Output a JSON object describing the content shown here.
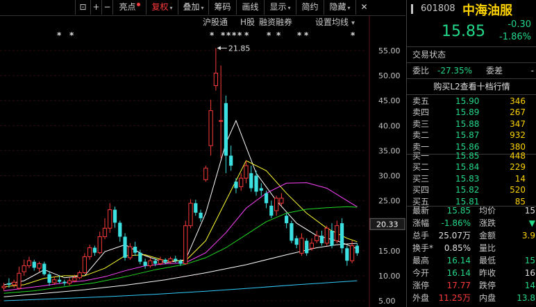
{
  "toolbar": {
    "items": [
      {
        "label": "⊡",
        "dot": false,
        "menu": false
      },
      {
        "label": "+",
        "dot": false,
        "menu": false
      },
      {
        "label": "−",
        "dot": false,
        "menu": false
      },
      {
        "label": "亮点",
        "dot": true,
        "menu": false
      },
      {
        "label": "复权",
        "dot": false,
        "menu": true
      },
      {
        "label": "叠加",
        "dot": false,
        "menu": true
      },
      {
        "label": "筹码",
        "dot": false,
        "menu": false
      },
      {
        "label": "画线",
        "dot": false,
        "menu": false
      },
      {
        "label": "显示",
        "dot": false,
        "menu": true
      },
      {
        "label": "简约",
        "dot": false,
        "menu": false
      },
      {
        "label": "隐藏",
        "dot": false,
        "menu": true
      },
      {
        "label": "✕",
        "dot": false,
        "menu": false
      }
    ]
  },
  "chart_header": {
    "tabs": [
      "沪股通",
      "H股",
      "融资融券",
      "设置均线"
    ],
    "settings_arrow": "▾"
  },
  "chart_data": {
    "type": "candlestick",
    "y_ticks": [
      "55.00",
      "50.00",
      "45.00",
      "40.00",
      "35.00",
      "30.00",
      "25.00",
      "20.00",
      "15.00",
      "10.00",
      "5.00"
    ],
    "ylim": [
      5,
      55
    ],
    "current_price_label": "20.33",
    "peak_annotation": "21.85",
    "candles": [
      {
        "o": 7.6,
        "c": 7.9,
        "h": 8.6,
        "l": 7.0
      },
      {
        "o": 8.5,
        "c": 8.2,
        "h": 9.5,
        "l": 7.6
      },
      {
        "o": 8.2,
        "c": 8.7,
        "h": 9.2,
        "l": 7.6
      },
      {
        "o": 7.5,
        "c": 10.5,
        "h": 11.8,
        "l": 7.2
      },
      {
        "o": 10.8,
        "c": 12.0,
        "h": 13.2,
        "l": 10.0
      },
      {
        "o": 12.0,
        "c": 13.0,
        "h": 13.8,
        "l": 11.5
      },
      {
        "o": 12.8,
        "c": 11.6,
        "h": 13.2,
        "l": 11.0
      },
      {
        "o": 11.5,
        "c": 12.4,
        "h": 12.8,
        "l": 10.8
      },
      {
        "o": 12.4,
        "c": 10.3,
        "h": 12.8,
        "l": 10.0
      },
      {
        "o": 10.3,
        "c": 8.6,
        "h": 10.8,
        "l": 8.0
      },
      {
        "o": 8.6,
        "c": 9.2,
        "h": 9.8,
        "l": 8.2
      },
      {
        "o": 9.2,
        "c": 8.8,
        "h": 10.0,
        "l": 8.4
      },
      {
        "o": 8.8,
        "c": 8.5,
        "h": 9.2,
        "l": 8.0
      },
      {
        "o": 8.5,
        "c": 9.0,
        "h": 9.6,
        "l": 8.1
      },
      {
        "o": 9.0,
        "c": 9.6,
        "h": 10.2,
        "l": 8.7
      },
      {
        "o": 9.6,
        "c": 10.6,
        "h": 11.0,
        "l": 9.3
      },
      {
        "o": 10.6,
        "c": 13.8,
        "h": 14.5,
        "l": 10.4
      },
      {
        "o": 13.8,
        "c": 15.6,
        "h": 16.2,
        "l": 13.2
      },
      {
        "o": 15.6,
        "c": 14.6,
        "h": 16.0,
        "l": 14.0
      },
      {
        "o": 14.6,
        "c": 17.8,
        "h": 18.8,
        "l": 14.3
      },
      {
        "o": 17.8,
        "c": 19.5,
        "h": 21.5,
        "l": 17.3
      },
      {
        "o": 19.5,
        "c": 23.2,
        "h": 24.5,
        "l": 18.6
      },
      {
        "o": 23.2,
        "c": 20.6,
        "h": 23.8,
        "l": 19.6
      },
      {
        "o": 20.6,
        "c": 17.8,
        "h": 21.0,
        "l": 16.8
      },
      {
        "o": 17.8,
        "c": 13.6,
        "h": 18.5,
        "l": 13.0
      },
      {
        "o": 13.6,
        "c": 15.8,
        "h": 16.5,
        "l": 13.2
      },
      {
        "o": 15.8,
        "c": 14.6,
        "h": 16.8,
        "l": 14.0
      },
      {
        "o": 14.6,
        "c": 12.8,
        "h": 15.2,
        "l": 12.3
      },
      {
        "o": 12.8,
        "c": 12.0,
        "h": 13.4,
        "l": 11.4
      },
      {
        "o": 12.0,
        "c": 13.0,
        "h": 13.6,
        "l": 11.6
      },
      {
        "o": 13.0,
        "c": 12.4,
        "h": 13.5,
        "l": 11.9
      },
      {
        "o": 12.4,
        "c": 13.2,
        "h": 13.8,
        "l": 12.1
      },
      {
        "o": 13.2,
        "c": 12.8,
        "h": 13.5,
        "l": 12.3
      },
      {
        "o": 12.8,
        "c": 13.4,
        "h": 13.8,
        "l": 12.4
      },
      {
        "o": 13.4,
        "c": 13.0,
        "h": 14.0,
        "l": 12.6
      },
      {
        "o": 13.0,
        "c": 12.4,
        "h": 13.3,
        "l": 12.0
      },
      {
        "o": 12.4,
        "c": 20.0,
        "h": 21.0,
        "l": 12.2
      },
      {
        "o": 20.0,
        "c": 24.5,
        "h": 25.3,
        "l": 19.5
      },
      {
        "o": 24.5,
        "c": 22.6,
        "h": 25.2,
        "l": 22.0
      },
      {
        "o": 22.6,
        "c": 21.5,
        "h": 23.2,
        "l": 20.8
      },
      {
        "o": 29.2,
        "c": 31.5,
        "h": 32.0,
        "l": 28.8
      },
      {
        "o": 36.0,
        "c": 43.0,
        "h": 45.2,
        "l": 34.0
      },
      {
        "o": 48.0,
        "c": 50.5,
        "h": 55.5,
        "l": 47.0
      },
      {
        "o": 41.0,
        "c": 41.0,
        "h": 52.0,
        "l": 33.5
      },
      {
        "o": 44.5,
        "c": 34.0,
        "h": 46.0,
        "l": 30.5
      },
      {
        "o": 34.0,
        "c": 32.0,
        "h": 36.0,
        "l": 31.0
      },
      {
        "o": 28.8,
        "c": 27.5,
        "h": 29.5,
        "l": 26.5
      },
      {
        "o": 27.8,
        "c": 29.5,
        "h": 30.5,
        "l": 27.0
      },
      {
        "o": 29.5,
        "c": 32.0,
        "h": 33.0,
        "l": 28.5
      },
      {
        "o": 30.5,
        "c": 27.5,
        "h": 32.0,
        "l": 26.8
      },
      {
        "o": 30.0,
        "c": 26.8,
        "h": 31.0,
        "l": 26.0
      },
      {
        "o": 27.5,
        "c": 27.0,
        "h": 28.5,
        "l": 26.0
      },
      {
        "o": 26.5,
        "c": 24.5,
        "h": 27.0,
        "l": 23.5
      },
      {
        "o": 24.0,
        "c": 22.0,
        "h": 25.0,
        "l": 21.5
      },
      {
        "o": 23.0,
        "c": 25.5,
        "h": 26.0,
        "l": 22.0
      },
      {
        "o": 24.5,
        "c": 25.5,
        "h": 26.5,
        "l": 24.0
      },
      {
        "o": 22.0,
        "c": 20.5,
        "h": 22.5,
        "l": 19.5
      },
      {
        "o": 20.5,
        "c": 17.0,
        "h": 21.0,
        "l": 16.5
      },
      {
        "o": 17.5,
        "c": 16.2,
        "h": 18.0,
        "l": 15.5
      },
      {
        "o": 14.5,
        "c": 17.5,
        "h": 18.5,
        "l": 14.0
      },
      {
        "o": 17.0,
        "c": 14.5,
        "h": 17.5,
        "l": 14.0
      },
      {
        "o": 15.5,
        "c": 16.5,
        "h": 17.5,
        "l": 15.0
      },
      {
        "o": 17.0,
        "c": 18.0,
        "h": 19.0,
        "l": 16.5
      },
      {
        "o": 18.0,
        "c": 16.5,
        "h": 19.0,
        "l": 16.0
      },
      {
        "o": 16.5,
        "c": 19.5,
        "h": 20.0,
        "l": 16.0
      },
      {
        "o": 19.0,
        "c": 16.0,
        "h": 20.5,
        "l": 15.5
      },
      {
        "o": 17.0,
        "c": 20.0,
        "h": 21.0,
        "l": 16.5
      },
      {
        "o": 20.5,
        "c": 15.5,
        "h": 21.5,
        "l": 14.5
      },
      {
        "o": 15.5,
        "c": 13.0,
        "h": 16.0,
        "l": 12.0
      },
      {
        "o": 13.0,
        "c": 16.0,
        "h": 17.0,
        "l": 12.5
      },
      {
        "o": 16.0,
        "c": 14.5,
        "h": 16.5,
        "l": 14.0
      }
    ],
    "ma_lines": [
      {
        "color": "#ffffff",
        "points": [
          [
            0,
            8.2
          ],
          [
            4,
            9.0
          ],
          [
            8,
            11.2
          ],
          [
            12,
            9.6
          ],
          [
            16,
            10.0
          ],
          [
            20,
            14.8
          ],
          [
            24,
            16.2
          ],
          [
            28,
            14.0
          ],
          [
            32,
            12.6
          ],
          [
            36,
            13.2
          ],
          [
            40,
            22.5
          ],
          [
            44,
            36.5
          ],
          [
            46,
            41.0
          ],
          [
            50,
            30.5
          ],
          [
            54,
            25.0
          ],
          [
            58,
            20.5
          ],
          [
            62,
            18.0
          ],
          [
            66,
            17.0
          ],
          [
            70,
            15.4
          ]
        ]
      },
      {
        "color": "#ffff33",
        "points": [
          [
            0,
            7.8
          ],
          [
            4,
            8.2
          ],
          [
            8,
            9.5
          ],
          [
            12,
            10.0
          ],
          [
            16,
            10.0
          ],
          [
            20,
            11.5
          ],
          [
            24,
            14.0
          ],
          [
            28,
            14.2
          ],
          [
            32,
            13.0
          ],
          [
            36,
            13.0
          ],
          [
            40,
            17.0
          ],
          [
            44,
            25.0
          ],
          [
            48,
            33.0
          ],
          [
            52,
            31.0
          ],
          [
            56,
            26.5
          ],
          [
            60,
            22.5
          ],
          [
            64,
            19.5
          ],
          [
            68,
            17.5
          ],
          [
            70,
            16.8
          ]
        ]
      },
      {
        "color": "#ff44ff",
        "points": [
          [
            0,
            7.0
          ],
          [
            4,
            7.5
          ],
          [
            8,
            8.0
          ],
          [
            12,
            8.6
          ],
          [
            16,
            9.0
          ],
          [
            20,
            9.8
          ],
          [
            24,
            11.0
          ],
          [
            28,
            12.0
          ],
          [
            32,
            12.4
          ],
          [
            36,
            12.6
          ],
          [
            40,
            14.6
          ],
          [
            44,
            18.6
          ],
          [
            48,
            23.5
          ],
          [
            52,
            26.5
          ],
          [
            56,
            28.5
          ],
          [
            60,
            28.6
          ],
          [
            64,
            27.5
          ],
          [
            68,
            25.0
          ],
          [
            70,
            23.8
          ]
        ]
      },
      {
        "color": "#22dd22",
        "points": [
          [
            0,
            6.5
          ],
          [
            6,
            7.0
          ],
          [
            12,
            7.8
          ],
          [
            18,
            8.6
          ],
          [
            24,
            9.8
          ],
          [
            30,
            11.2
          ],
          [
            36,
            12.3
          ],
          [
            40,
            13.6
          ],
          [
            44,
            15.6
          ],
          [
            48,
            18.2
          ],
          [
            52,
            20.8
          ],
          [
            56,
            22.5
          ],
          [
            60,
            23.3
          ],
          [
            64,
            23.6
          ],
          [
            68,
            23.8
          ],
          [
            70,
            23.7
          ]
        ]
      },
      {
        "color": "#ffffff",
        "points": [
          [
            0,
            5.8
          ],
          [
            8,
            6.5
          ],
          [
            16,
            7.2
          ],
          [
            24,
            8.1
          ],
          [
            32,
            9.2
          ],
          [
            40,
            10.6
          ],
          [
            48,
            12.2
          ],
          [
            56,
            14.2
          ],
          [
            62,
            15.6
          ],
          [
            66,
            16.2
          ],
          [
            70,
            16.5
          ]
        ]
      },
      {
        "color": "#33ccff",
        "points": [
          [
            0,
            5.0
          ],
          [
            10,
            5.4
          ],
          [
            20,
            5.8
          ],
          [
            30,
            6.3
          ],
          [
            40,
            6.9
          ],
          [
            50,
            7.6
          ],
          [
            58,
            8.2
          ],
          [
            64,
            8.6
          ],
          [
            70,
            9.0
          ]
        ]
      }
    ],
    "star_marker_rows": [
      "*  *",
      "* ****  * *  * *",
      "* *  *"
    ]
  },
  "panel": {
    "code": "601808",
    "name": "中海油服",
    "price": "15.85",
    "change": "-0.30",
    "change_pct": "-1.86%",
    "trade_status_label": "交易状态",
    "weibi_label": "委比",
    "weibi_value": "-27.35%",
    "weicha_label": "委差",
    "weicha_value": "-",
    "l2_link": "购买L2查看十档行情",
    "asks": [
      {
        "label": "卖五",
        "price": "15.90",
        "vol": "346"
      },
      {
        "label": "卖四",
        "price": "15.89",
        "vol": "267"
      },
      {
        "label": "卖三",
        "price": "15.88",
        "vol": "347"
      },
      {
        "label": "卖二",
        "price": "15.87",
        "vol": "932"
      },
      {
        "label": "卖一",
        "price": "15.86",
        "vol": "380"
      }
    ],
    "bids": [
      {
        "label": "买一",
        "price": "15.85",
        "vol": "448"
      },
      {
        "label": "买二",
        "price": "15.84",
        "vol": "229"
      },
      {
        "label": "买三",
        "price": "15.83",
        "vol": "14"
      },
      {
        "label": "买四",
        "price": "15.82",
        "vol": "520"
      },
      {
        "label": "买五",
        "price": "15.81",
        "vol": "85"
      }
    ],
    "stats": [
      {
        "l1": "最新",
        "v1": "15.85",
        "c1": "green",
        "l2": "均价",
        "v2": "15",
        "c2": "white"
      },
      {
        "l1": "涨幅",
        "v1": "-1.86%",
        "c1": "green",
        "l2": "涨跌",
        "v2": "▼",
        "c2": "green"
      },
      {
        "l1": "总手",
        "v1": "25.07万",
        "c1": "white",
        "l2": "金额",
        "v2": "3.9",
        "c2": "yellow"
      },
      {
        "l1": "换手*",
        "v1": "0.85%",
        "c1": "white",
        "l2": "量比",
        "v2": "",
        "c2": "white"
      },
      {
        "l1": "最高",
        "v1": "16.14",
        "c1": "green",
        "l2": "最低",
        "v2": "15",
        "c2": "green"
      },
      {
        "l1": "今开",
        "v1": "16.14",
        "c1": "green",
        "l2": "昨收",
        "v2": "16",
        "c2": "white"
      },
      {
        "l1": "涨停",
        "v1": "17.77",
        "c1": "red",
        "l2": "跌停",
        "v2": "14",
        "c2": "green"
      },
      {
        "l1": "外盘",
        "v1": "11.25万",
        "c1": "red",
        "l2": "内盘",
        "v2": "13.8",
        "c2": "green"
      }
    ]
  }
}
